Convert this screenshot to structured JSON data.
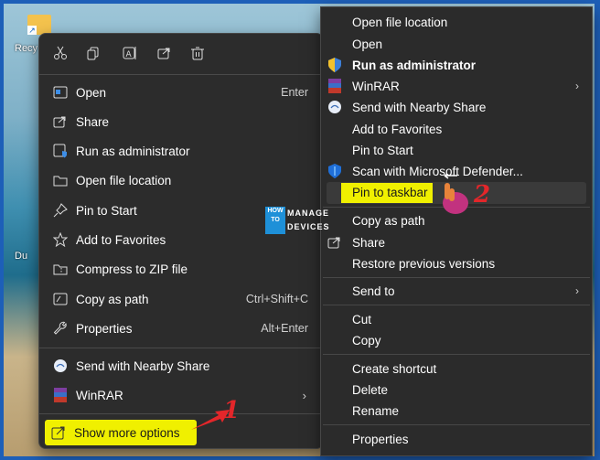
{
  "desktop": {
    "icon_name": "recycle-bin-shortcut-icon",
    "labels": [
      "Recy",
      "Du"
    ]
  },
  "modern_menu": {
    "toolbar": [
      {
        "name": "cut-icon",
        "glyph": "✂"
      },
      {
        "name": "copy-icon",
        "glyph": "⧉"
      },
      {
        "name": "rename-icon",
        "glyph": "A"
      },
      {
        "name": "share-icon",
        "glyph": "⇗"
      },
      {
        "name": "delete-icon",
        "glyph": "🗑"
      }
    ],
    "items": [
      {
        "label": "Open",
        "shortcut": "Enter",
        "icon": "open-icon"
      },
      {
        "label": "Share",
        "shortcut": "",
        "icon": "share-icon"
      },
      {
        "label": "Run as administrator",
        "shortcut": "",
        "icon": "shield-icon"
      },
      {
        "label": "Open file location",
        "shortcut": "",
        "icon": "folder-icon"
      },
      {
        "label": "Pin to Start",
        "shortcut": "",
        "icon": "pin-icon"
      },
      {
        "label": "Add to Favorites",
        "shortcut": "",
        "icon": "star-icon"
      },
      {
        "label": "Compress to ZIP file",
        "shortcut": "",
        "icon": "zip-icon"
      },
      {
        "label": "Copy as path",
        "shortcut": "Ctrl+Shift+C",
        "icon": "copy-path-icon"
      },
      {
        "label": "Properties",
        "shortcut": "Alt+Enter",
        "icon": "wrench-icon"
      }
    ],
    "nearby_share": "Send with Nearby Share",
    "winrar": "WinRAR",
    "show_more": "Show more options"
  },
  "classic_menu": {
    "group1": [
      {
        "label": "Open file location",
        "bold": false,
        "icon": "",
        "chevron": false
      },
      {
        "label": "Open",
        "bold": false,
        "icon": "",
        "chevron": false
      },
      {
        "label": "Run as administrator",
        "bold": true,
        "icon": "uac-shield-icon",
        "chevron": false
      },
      {
        "label": "WinRAR",
        "bold": false,
        "icon": "winrar-icon",
        "chevron": true
      },
      {
        "label": "Send with Nearby Share",
        "bold": false,
        "icon": "nearby-share-icon",
        "chevron": false
      },
      {
        "label": "Add to Favorites",
        "bold": false,
        "icon": "",
        "chevron": false
      },
      {
        "label": "Pin to Start",
        "bold": false,
        "icon": "",
        "chevron": false
      },
      {
        "label": "Scan with Microsoft Defender...",
        "bold": false,
        "icon": "defender-icon",
        "chevron": false
      }
    ],
    "pin_to_taskbar": "Pin to taskbar",
    "group2": [
      {
        "label": "Copy as path",
        "icon": ""
      },
      {
        "label": "Share",
        "icon": "share-icon"
      },
      {
        "label": "Restore previous versions",
        "icon": ""
      }
    ],
    "send_to": "Send to",
    "group3": [
      "Cut",
      "Copy"
    ],
    "group4": [
      "Create shortcut",
      "Delete",
      "Rename"
    ],
    "properties": "Properties"
  },
  "watermark": {
    "how_to": "HOW TO",
    "manage": "MANAGE",
    "devices": "DEVICES"
  },
  "annotations": {
    "step1": "1",
    "step2": "2",
    "color": "#e3262a"
  },
  "colors": {
    "highlight": "#f0f000",
    "menu_bg": "#2c2c2c",
    "border": "#1d5fb8"
  }
}
